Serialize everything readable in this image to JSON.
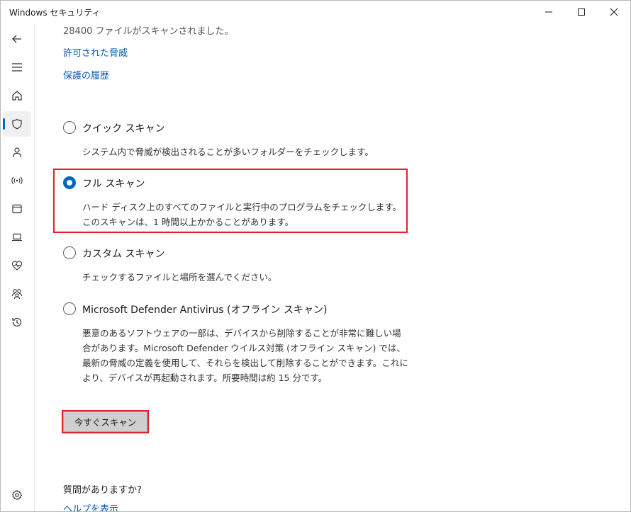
{
  "window": {
    "title": "Windows セキュリティ"
  },
  "titlebar_buttons": [
    "minimize-icon",
    "maximize-icon",
    "close-icon"
  ],
  "sidebar": {
    "items": [
      {
        "icon": "back-arrow-icon"
      },
      {
        "icon": "hamburger-menu-icon"
      },
      {
        "icon": "home-icon"
      },
      {
        "icon": "shield-icon",
        "active": true
      },
      {
        "icon": "person-icon"
      },
      {
        "icon": "wireless-icon"
      },
      {
        "icon": "app-browser-icon"
      },
      {
        "icon": "laptop-icon"
      },
      {
        "icon": "heart-pulse-icon"
      },
      {
        "icon": "family-icon"
      },
      {
        "icon": "history-icon"
      },
      {
        "icon": "settings-gear-icon"
      }
    ]
  },
  "main": {
    "scanned_text": "28400 ファイルがスキャンされました。",
    "links": {
      "allowed_threats": "許可された脅威",
      "protection_history": "保護の履歴"
    },
    "options": [
      {
        "label": "クイック スキャン",
        "description": "システム内で脅威が検出されることが多いフォルダーをチェックします。",
        "selected": false
      },
      {
        "label": "フル スキャン",
        "description": "ハード ディスク上のすべてのファイルと実行中のプログラムをチェックします。このスキャンは、1 時間以上かかることがあります。",
        "selected": true
      },
      {
        "label": "カスタム スキャン",
        "description": "チェックするファイルと場所を選んでください。",
        "selected": false
      },
      {
        "label": "Microsoft Defender Antivirus (オフライン スキャン)",
        "description": "悪意のあるソフトウェアの一部は、デバイスから削除することが非常に難しい場合があります。Microsoft Defender ウイルス対策 (オフライン スキャン) では、最新の脅威の定義を使用して、それらを検出して削除することができます。これにより、デバイスが再起動されます。所要時間は約 15 分です。",
        "selected": false
      }
    ],
    "scan_button": "今すぐスキャン",
    "question": "質問がありますか?",
    "help_link": "ヘルプを表示"
  },
  "colors": {
    "accent": "#0067c0",
    "link": "#0a58ae",
    "highlight_border": "#e2212a"
  }
}
